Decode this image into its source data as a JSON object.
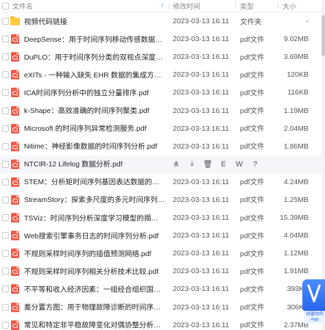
{
  "header": {
    "name_label": "文件名",
    "sort_arrow": "↑",
    "time_label": "修改时间",
    "type_label": "类型",
    "size_label": "大小"
  },
  "rows": [
    {
      "name": "视频代码链接",
      "time": "2023-03-13 16:11",
      "type": "文件夹",
      "size": "-",
      "icon": "folder-icon"
    },
    {
      "name": "DeepSense：用于时间序列移动传感数据处理的统一深度学习框架.pdf",
      "time": "2023-03-13 16:11",
      "type": "pdf文件",
      "size": "9.02MB",
      "icon": "pdf-icon"
    },
    {
      "name": "DuPLO：用于时间序列分类的双视点深度学习架构.pdf",
      "time": "2023-03-13 16:11",
      "type": "pdf文件",
      "size": "3.69MB",
      "icon": "pdf-icon"
    },
    {
      "name": "eXITs - 一种输入缺失 EHR 数据的集成方法.pdf",
      "time": "2023-03-13 16:11",
      "type": "pdf文件",
      "size": "120KB",
      "icon": "pdf-icon"
    },
    {
      "name": "ICA时间序列分析中的独立分量排序.pdf",
      "time": "2023-03-13 16:11",
      "type": "pdf文件",
      "size": "116KB",
      "icon": "pdf-icon"
    },
    {
      "name": "k-Shape：高效准确的时间序列聚类.pdf",
      "time": "2023-03-13 16:11",
      "type": "pdf文件",
      "size": "1.19MB",
      "icon": "pdf-icon"
    },
    {
      "name": "Microsoft 的时间序列异常检测服务.pdf",
      "time": "2023-03-13 16:11",
      "type": "pdf文件",
      "size": "2.04MB",
      "icon": "pdf-icon"
    },
    {
      "name": "Nitime：神经影像数据的时间序列分析.pdf",
      "time": "2023-03-13 16:11",
      "type": "pdf文件",
      "size": "1.86MB",
      "icon": "pdf-icon"
    },
    {
      "name": "NTCIR-12 Lifelog 数据分析.pdf",
      "time": "",
      "type": "",
      "size": "",
      "icon": "pdf-icon",
      "hover": true
    },
    {
      "name": "STEM：分析矩时间序列基因表达数据的工具.pdf",
      "time": "2023-03-13 16:11",
      "type": "pdf文件",
      "size": "4.24MB",
      "icon": "pdf-icon"
    },
    {
      "name": "StreamStory：探索多尺度的多元时间序列.pdf",
      "time": "2023-03-13 16:11",
      "type": "pdf文件",
      "size": "1.25MB",
      "icon": "pdf-icon"
    },
    {
      "name": "TSViz：时间序列分析深度学习模型的揭秘.pdf",
      "time": "2023-03-13 16:11",
      "type": "pdf文件",
      "size": "15.39MB",
      "icon": "pdf-icon"
    },
    {
      "name": "Web搜索引擎事务日志的时间序列分析.pdf",
      "time": "2023-03-13 16:11",
      "type": "pdf文件",
      "size": "4.04MB",
      "icon": "pdf-icon"
    },
    {
      "name": "不规则采样时间序列的插值预测网络.pdf",
      "time": "2023-03-13 16:11",
      "type": "pdf文件",
      "size": "1.12MB",
      "icon": "pdf-icon"
    },
    {
      "name": "不规则采样时间序列相关分析技术比较.pdf",
      "time": "2023-03-13 16:11",
      "type": "pdf文件",
      "size": "1.91MB",
      "icon": "pdf-icon"
    },
    {
      "name": "不平等和收入经济因素：一组经合组织国家的时间序列分析.pdf",
      "time": "2023-03-13 16:11",
      "type": "pdf文件",
      "size": "393KB",
      "icon": "pdf-icon"
    },
    {
      "name": "差分置方图：用于物理故障诊断的时间序列分析新工具.pdf",
      "time": "2023-03-13 16:11",
      "type": "pdf文件",
      "size": "306KB",
      "icon": "pdf-icon"
    },
    {
      "name": "常见和特定非平稳故障变化对偶协整分析的故障诊断.pdf",
      "time": "2023-03-13 16:11",
      "type": "pdf文件",
      "size": "2.37MB",
      "icon": "pdf-icon"
    }
  ],
  "hover_actions": [
    {
      "name": "share-icon",
      "glyph": "⋔"
    },
    {
      "name": "download-icon",
      "glyph": "⤓"
    },
    {
      "name": "delete-icon",
      "glyph": "🗑"
    },
    {
      "name": "text-extract-icon",
      "glyph": "E"
    },
    {
      "name": "word-convert-icon",
      "glyph": "W"
    },
    {
      "name": "more-icon",
      "glyph": "?"
    }
  ],
  "badge": {
    "letter": "V",
    "caption": "创建你的App"
  },
  "colors": {
    "pdf_red": "#f05a4a",
    "folder_yellow": "#ffc93c",
    "accent_blue": "#2563eb",
    "hover_bg": "#f4f6fa"
  }
}
